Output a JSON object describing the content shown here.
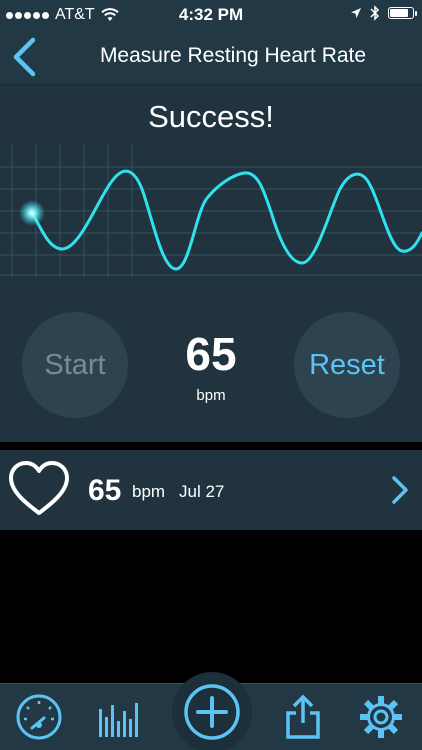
{
  "status_bar": {
    "carrier": "AT&T",
    "time": "4:32 PM",
    "battery_level": 0.85
  },
  "nav": {
    "title": "Measure Resting Heart Rate"
  },
  "measure": {
    "status": "Success!",
    "start_label": "Start",
    "reset_label": "Reset",
    "bpm_value": "65",
    "bpm_unit": "bpm"
  },
  "history": {
    "items": [
      {
        "bpm": "65",
        "unit": "bpm",
        "date": "Jul 27"
      }
    ]
  },
  "tabs": [
    {
      "icon": "speedometer-icon"
    },
    {
      "icon": "bar-chart-icon"
    },
    {
      "icon": "add-icon"
    },
    {
      "icon": "share-icon"
    },
    {
      "icon": "gear-icon"
    }
  ],
  "colors": {
    "accent": "#5bc4f4",
    "wave": "#2fe3ee",
    "panel": "#21333f",
    "bar": "#233845"
  }
}
